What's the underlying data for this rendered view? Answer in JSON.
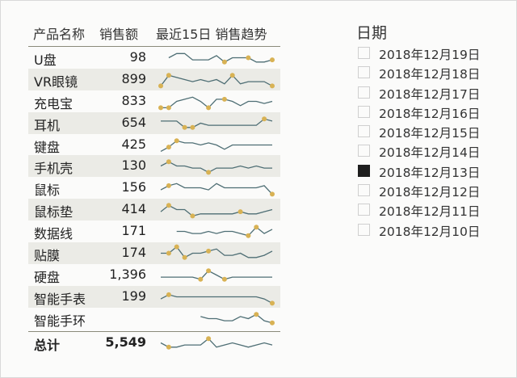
{
  "table": {
    "headers": {
      "name": "产品名称",
      "sales": "销售额",
      "trend": "最近15日 销售趋势"
    },
    "rows": [
      {
        "name": "U盘",
        "sales": "98",
        "trend": [
          null,
          4,
          6,
          6,
          3,
          3,
          3,
          5,
          2,
          4,
          4,
          4,
          2,
          2,
          3
        ],
        "highlights": [
          8,
          11,
          14
        ]
      },
      {
        "name": "VR眼镜",
        "sales": "899",
        "trend": [
          1,
          6,
          5,
          4,
          3,
          4,
          3,
          4,
          2,
          6,
          2,
          3,
          3,
          3,
          1
        ],
        "highlights": [
          0,
          1,
          9,
          14
        ]
      },
      {
        "name": "充电宝",
        "sales": "833",
        "trend": [
          1,
          1,
          4,
          5,
          6,
          4,
          1,
          5,
          5,
          4,
          2,
          4,
          4,
          3,
          4
        ],
        "highlights": [
          0,
          1,
          6,
          8
        ]
      },
      {
        "name": "耳机",
        "sales": "654",
        "trend": [
          5,
          5,
          5,
          2,
          2,
          4,
          3,
          3,
          3,
          3,
          3,
          3,
          3,
          6,
          5
        ],
        "highlights": [
          3,
          4,
          13
        ]
      },
      {
        "name": "键盘",
        "sales": "425",
        "trend": [
          1,
          3,
          6,
          5,
          5,
          4,
          5,
          4,
          2,
          4,
          4,
          4,
          4,
          4,
          4
        ],
        "highlights": [
          1,
          2
        ]
      },
      {
        "name": "手机壳",
        "sales": "130",
        "trend": [
          4,
          6,
          4,
          4,
          3,
          3,
          1,
          3,
          3,
          3,
          4,
          3,
          4,
          3,
          3
        ],
        "highlights": [
          1,
          6
        ]
      },
      {
        "name": "鼠标",
        "sales": "156",
        "trend": [
          3,
          5,
          6,
          4,
          4,
          4,
          3,
          6,
          4,
          4,
          4,
          4,
          4,
          5,
          1
        ],
        "highlights": [
          1,
          14
        ]
      },
      {
        "name": "鼠标垫",
        "sales": "414",
        "trend": [
          3,
          6,
          4,
          4,
          1,
          2,
          2,
          2,
          2,
          2,
          3,
          2,
          2,
          3,
          4
        ],
        "highlights": [
          1,
          4,
          10
        ]
      },
      {
        "name": "数据线",
        "sales": "171",
        "trend": [
          null,
          null,
          4,
          4,
          3,
          3,
          4,
          3,
          4,
          4,
          3,
          2,
          6,
          3,
          5
        ],
        "highlights": [
          11,
          12
        ]
      },
      {
        "name": "贴膜",
        "sales": "174",
        "trend": [
          4,
          4,
          7,
          2,
          4,
          4,
          5,
          6,
          3,
          3,
          4,
          2,
          2,
          3,
          5
        ],
        "highlights": [
          1,
          2,
          3,
          6
        ]
      },
      {
        "name": "硬盘",
        "sales": "1,396",
        "trend": [
          3,
          3,
          3,
          3,
          3,
          2,
          6,
          4,
          2,
          3,
          3,
          3,
          3,
          3,
          3
        ],
        "highlights": [
          5,
          6,
          8
        ]
      },
      {
        "name": "智能手表",
        "sales": "199",
        "trend": [
          3,
          5,
          4,
          4,
          4,
          4,
          4,
          4,
          4,
          4,
          4,
          4,
          4,
          3,
          1
        ],
        "highlights": [
          1,
          14
        ]
      },
      {
        "name": "智能手环",
        "sales": "",
        "trend": [
          null,
          null,
          null,
          null,
          null,
          5,
          4,
          4,
          3,
          3,
          5,
          4,
          6,
          3,
          2
        ],
        "highlights": [
          12,
          14
        ]
      }
    ],
    "total": {
      "name": "总计",
      "sales": "5,549",
      "trend": [
        4,
        2,
        2,
        3,
        3,
        3,
        6,
        2,
        3,
        4,
        3,
        2,
        3,
        4,
        3
      ],
      "highlights": [
        1,
        6
      ]
    }
  },
  "filter": {
    "title": "日期",
    "options": [
      {
        "label": "2018年12月19日",
        "selected": false
      },
      {
        "label": "2018年12月18日",
        "selected": false
      },
      {
        "label": "2018年12月17日",
        "selected": false
      },
      {
        "label": "2018年12月16日",
        "selected": false
      },
      {
        "label": "2018年12月15日",
        "selected": false
      },
      {
        "label": "2018年12月14日",
        "selected": false
      },
      {
        "label": "2018年12月13日",
        "selected": true
      },
      {
        "label": "2018年12月12日",
        "selected": false
      },
      {
        "label": "2018年12月11日",
        "selected": false
      },
      {
        "label": "2018年12月10日",
        "selected": false
      }
    ]
  },
  "colors": {
    "line": "#4e6e74",
    "highlight": "#d8b254",
    "band": "#ebebe6"
  }
}
